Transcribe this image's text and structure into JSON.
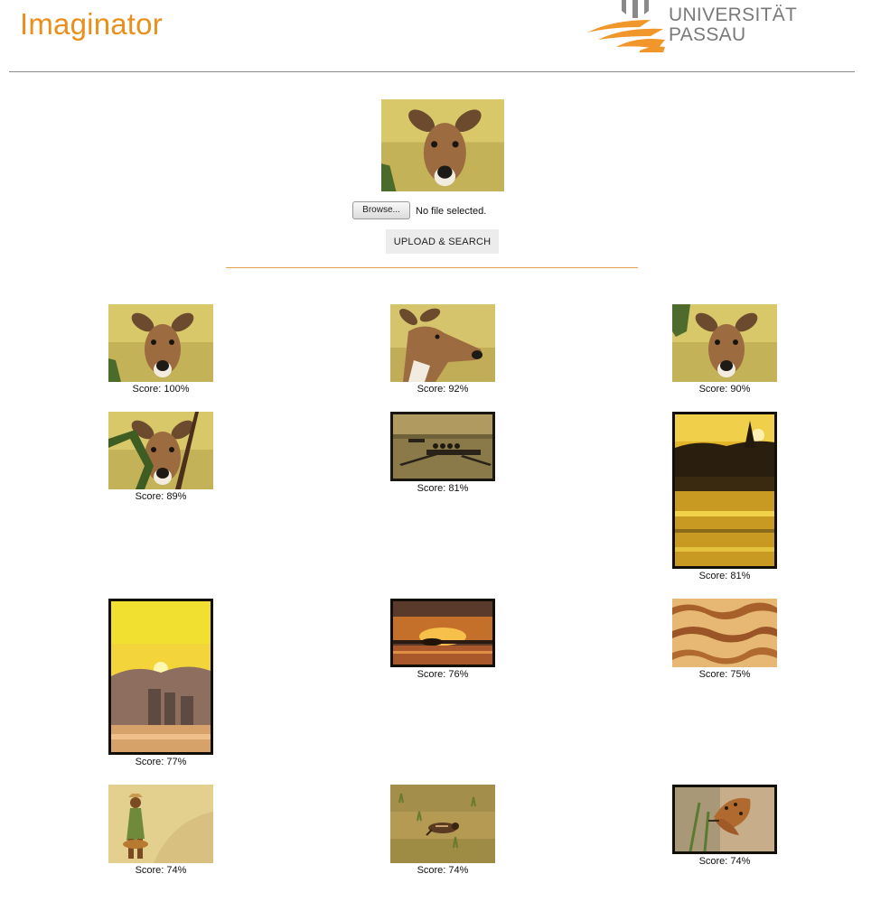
{
  "app": {
    "title": "Imaginator"
  },
  "logo": {
    "line1": "UNIVERSITÄT",
    "line2": "PASSAU"
  },
  "upload": {
    "browse_label": "Browse...",
    "file_status": "No file selected.",
    "submit_label": "UPLOAD & SEARCH"
  },
  "results": [
    {
      "score": "Score: 100%",
      "image": "deer-face"
    },
    {
      "score": "Score: 92%",
      "image": "deer-profile"
    },
    {
      "score": "Score: 90%",
      "image": "deer-face"
    },
    {
      "score": "Score: 89%",
      "image": "deer-branches"
    },
    {
      "score": "Score: 81%",
      "image": "rowers-lake"
    },
    {
      "score": "Score: 81%",
      "image": "sunset-lake-portrait"
    },
    {
      "score": "Score: 77%",
      "image": "sunset-city-portrait"
    },
    {
      "score": "Score: 76%",
      "image": "sunset-island"
    },
    {
      "score": "Score: 75%",
      "image": "texture-marble"
    },
    {
      "score": "Score: 74%",
      "image": "woman-dunes"
    },
    {
      "score": "Score: 74%",
      "image": "bird-grass"
    },
    {
      "score": "Score: 74%",
      "image": "butterfly"
    }
  ],
  "colors": {
    "brand": "#e8901b",
    "divider_orange": "#e8a34a",
    "divider_gray": "#8a8a8a"
  }
}
